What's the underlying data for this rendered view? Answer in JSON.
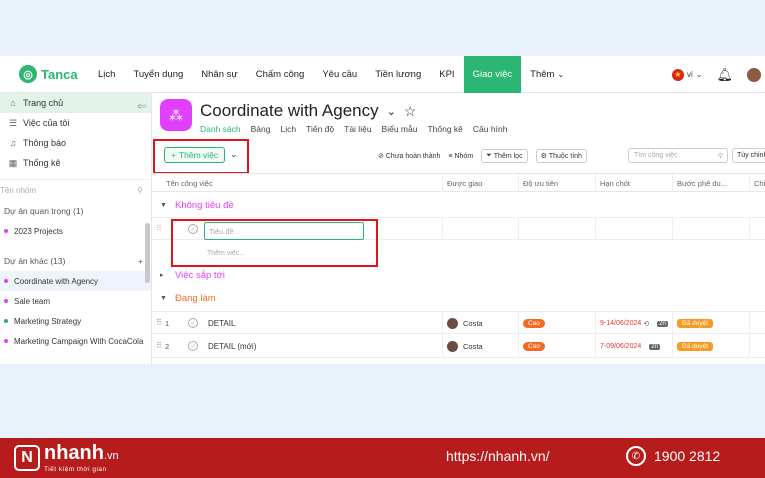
{
  "nav": {
    "logo_text": "Tanca",
    "items": [
      "Lịch",
      "Tuyển dụng",
      "Nhân sự",
      "Chấm công",
      "Yêu cầu",
      "Tiền lương",
      "KPI",
      "Giao việc",
      "Thêm"
    ],
    "lang": "vi"
  },
  "sidebar": {
    "items": [
      "Trang chủ",
      "Việc của tôi",
      "Thông báo",
      "Thống kê"
    ],
    "search_placeholder": "Tên nhóm",
    "group1": "Dự án quan trọng (1)",
    "group1_projects": [
      "2023 Projects"
    ],
    "group2": "Dự án khác (13)",
    "group2_projects": [
      "Coordinate with Agency",
      "Sale team",
      "Marketing Strategy",
      "Marketing Campaign With CocaCola"
    ]
  },
  "project": {
    "title": "Coordinate with Agency",
    "tabs": [
      "Danh sách",
      "Bảng",
      "Lịch",
      "Tiến độ",
      "Tài liệu",
      "Biểu mẫu",
      "Thống kê",
      "Cấu hình"
    ]
  },
  "toolbar": {
    "add_label": "Thêm việc",
    "tools": [
      "Chưa hoàn thành",
      "Nhóm",
      "Thêm lọc",
      "Thuộc tính"
    ],
    "search_placeholder": "Tìm công việc",
    "custom_label": "Tùy chỉnh"
  },
  "table": {
    "headers": [
      "Tên công việc",
      "Được giao",
      "Độ ưu tiên",
      "Hạn chót",
      "Bước phê du...",
      "Chi"
    ]
  },
  "groups": {
    "untitled": "Không tiêu đề",
    "new_task_placeholder": "Tiêu đề",
    "new_task_hint": "Thêm việc...",
    "upcoming": "Việc sắp tới",
    "in_progress": "Đang làm"
  },
  "tasks": [
    {
      "index": "1",
      "name": "DETAIL",
      "assignee": "Costa",
      "priority": "Cao",
      "due": "9-14/06/2024",
      "badge": "2n",
      "approval": "Đã duyệt"
    },
    {
      "index": "2",
      "name": "DETAIL (mới)",
      "assignee": "Costa",
      "priority": "Cao",
      "due": "7-09/06/2024",
      "badge": "2n",
      "approval": "Đã duyệt"
    }
  ],
  "footer": {
    "brand": "nhanh",
    "brand_suffix": ".vn",
    "slogan": "Tiết kiệm thời gian",
    "url": "https://nhanh.vn/",
    "phone": "1900 2812"
  },
  "colors": {
    "accent": "#2bb673",
    "project_icon": "#e040fb",
    "footer_bg": "#b71c1c",
    "highlight_box": "#e0141c"
  }
}
